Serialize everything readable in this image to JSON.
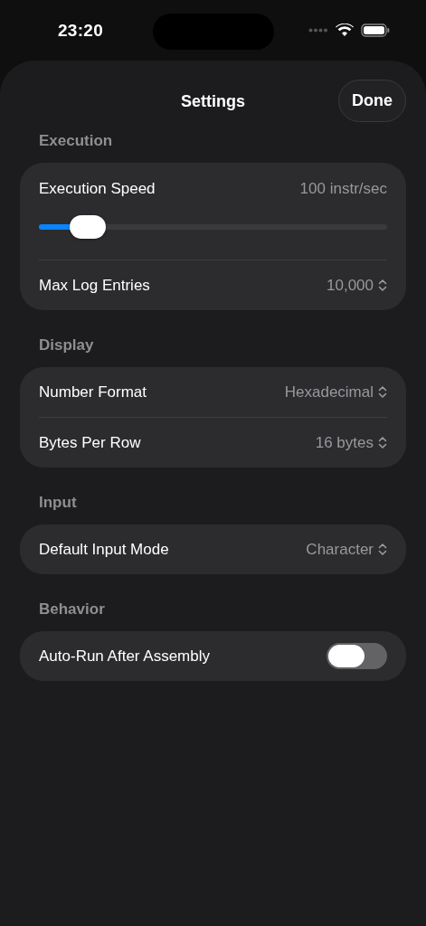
{
  "status_bar": {
    "time": "23:20"
  },
  "header": {
    "title": "Settings",
    "done_button": "Done"
  },
  "sections": [
    {
      "title": "Execution",
      "rows": [
        {
          "kind": "slider",
          "label": "Execution Speed",
          "value": "100 instr/sec",
          "level": 0.14
        },
        {
          "kind": "picker",
          "label": "Max Log Entries",
          "value": "10,000"
        }
      ]
    },
    {
      "title": "Display",
      "rows": [
        {
          "kind": "picker",
          "label": "Number Format",
          "value": "Hexadecimal"
        },
        {
          "kind": "picker",
          "label": "Bytes Per Row",
          "value": "16 bytes"
        }
      ]
    },
    {
      "title": "Input",
      "rows": [
        {
          "kind": "picker",
          "label": "Default Input Mode",
          "value": "Character"
        }
      ]
    },
    {
      "title": "Behavior",
      "rows": [
        {
          "kind": "toggle",
          "label": "Auto-Run After Assembly",
          "on": false
        }
      ]
    }
  ]
}
